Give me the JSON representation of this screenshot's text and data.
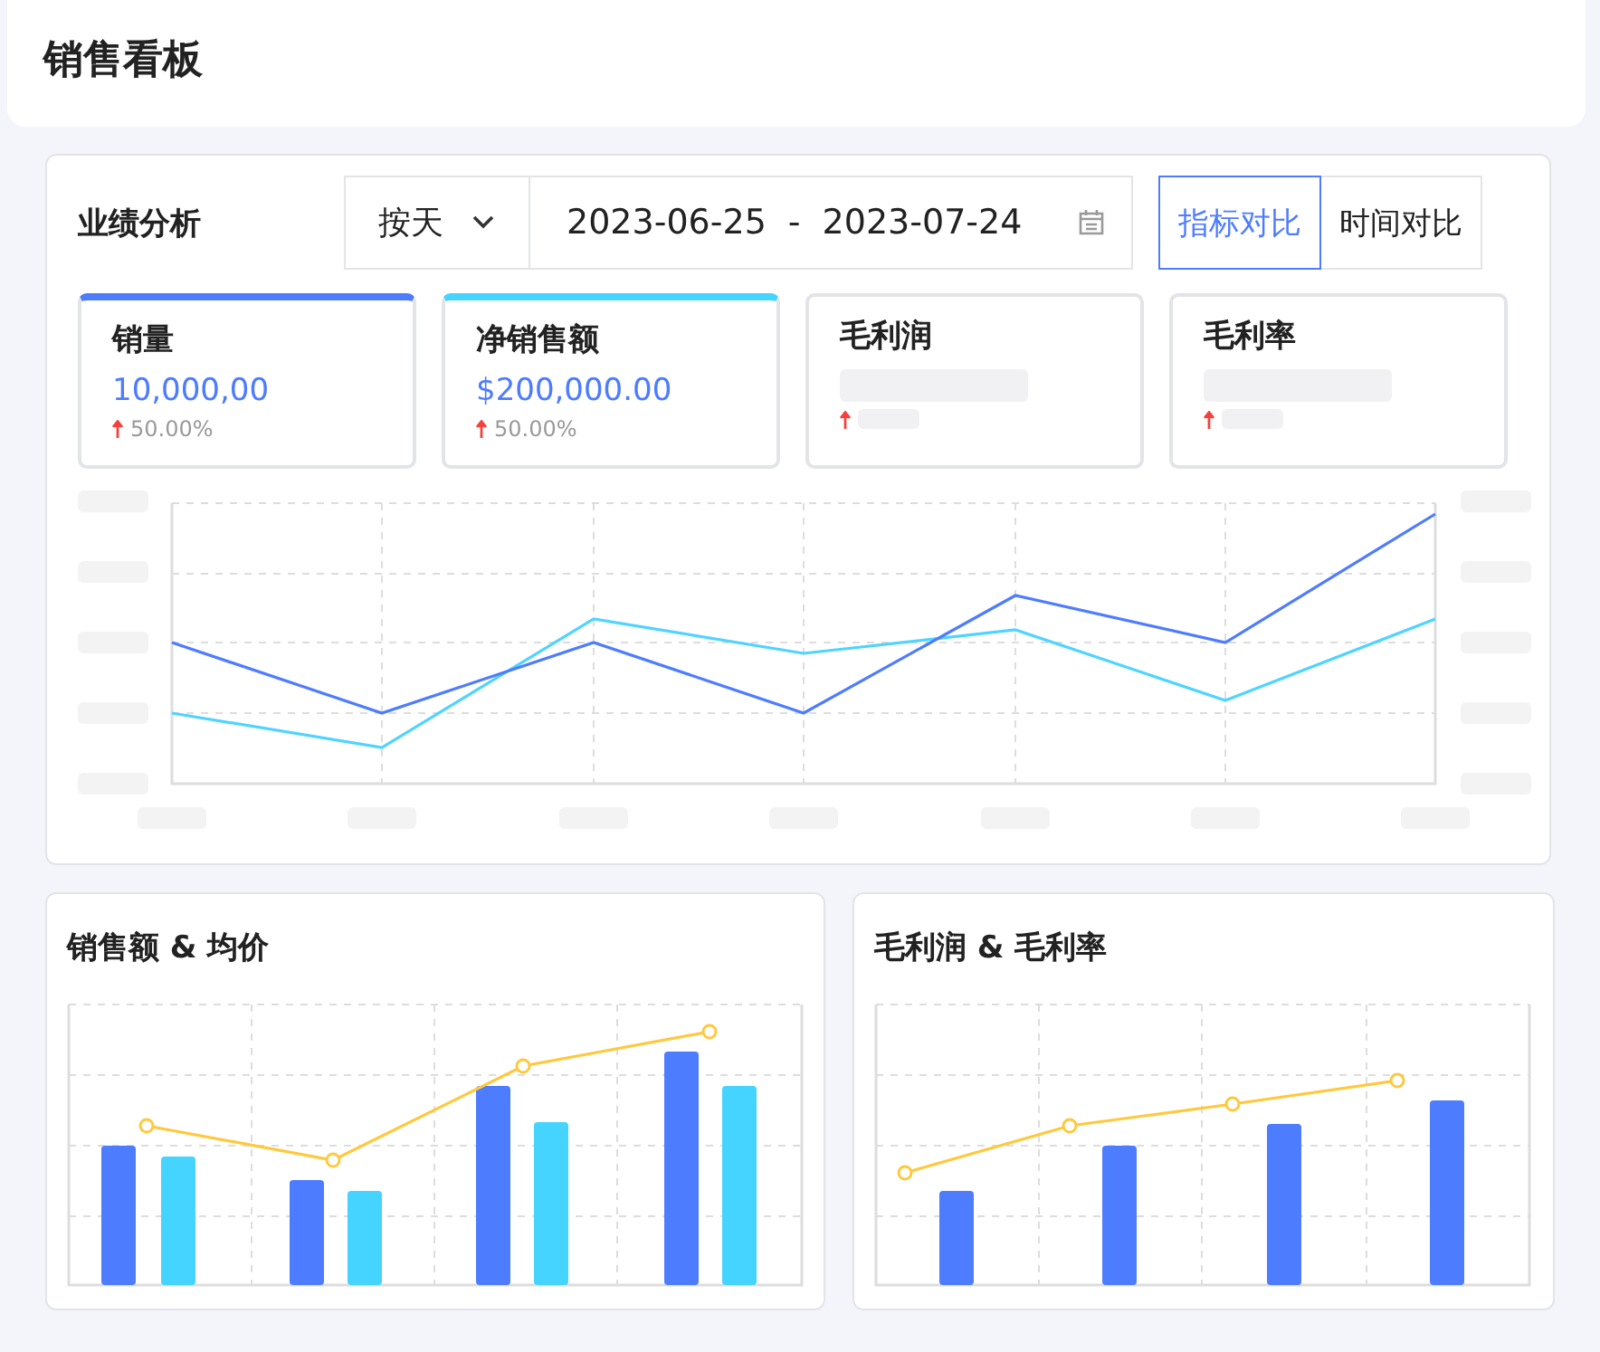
{
  "header": {
    "title": "销售看板"
  },
  "performance": {
    "title": "业绩分析",
    "granularity": {
      "value": "按天"
    },
    "date_range": {
      "start": "2023-06-25",
      "separator": "-",
      "end": "2023-07-24"
    },
    "compare_modes": [
      {
        "label": "指标对比",
        "selected": true
      },
      {
        "label": "时间对比",
        "selected": false
      }
    ],
    "metrics": [
      {
        "label": "销量",
        "value": "10,000,00",
        "change": "50.00%",
        "selected": true,
        "color": "#4e7cff",
        "loading": false
      },
      {
        "label": "净销售额",
        "value": "$200,000.00",
        "change": "50.00%",
        "selected": true,
        "color": "#44d4ff",
        "loading": false
      },
      {
        "label": "毛利润",
        "selected": false,
        "loading": true
      },
      {
        "label": "毛利率",
        "selected": false,
        "loading": true
      }
    ]
  },
  "charts": [
    {
      "title": "销售额 & 均价",
      "kind": "grouped"
    },
    {
      "title": "毛利润 & 毛利率",
      "kind": "single"
    }
  ]
}
